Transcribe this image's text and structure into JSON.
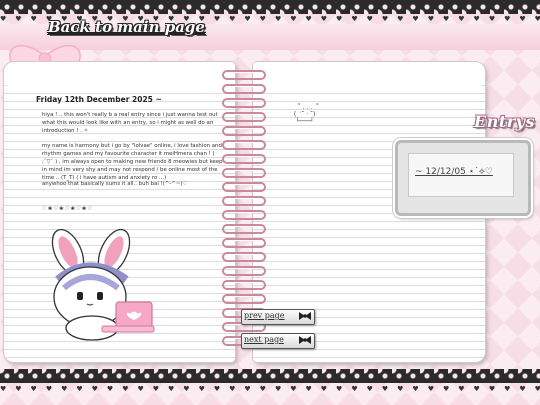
{
  "nav": {
    "back_label": "Back to main page"
  },
  "decor": {
    "hearts": "♥♥♥♥♥♥♥♥♥♥♥♥♥♥♥♥♥♥♥♥♥♥♥♥♥♥♥♥♥♥♥♥♥♥♥♥♥♥♥♥♥♥♥♥"
  },
  "diary": {
    "date": "Friday 12th December 2025 ~",
    "paragraphs": [
      "hiya ! .. this won't really b a real entry since i just wanna test out what this would look like with an entry, so i might as well do an introduction ! . ✧",
      "my name is harmony but i go by \"lolvae\" online, i love fashion and rhythm games and my favourite character it meiHmera chan ! ( ;˘▽˘ ) , im always open to making new friends 8 meowies but keep in mind im very shy and may not respond / be online most of the time .. (T_T) ( i have autism and anxiety ro ...)",
      "anywhoo that basically sums it all.. buh bai !(^-^~)♡"
    ],
    "signature": "♡❀♡❀♡❀♡❀♡",
    "kaomoji": "    ˚ . . .  ˚\n  (  ′˘ · ˘)\n   └───┘"
  },
  "entries": {
    "title": "Entrys",
    "items": [
      {
        "label": "~ 12/12/05 ⋆˙⟡♡"
      }
    ]
  },
  "pager": {
    "prev_label": "prev page",
    "next_label": "next page"
  },
  "colors": {
    "background": "#f6dde6",
    "ring": "#c98a9a",
    "lace": "#2b2b2b",
    "accent_pink": "#f4a5c0"
  }
}
